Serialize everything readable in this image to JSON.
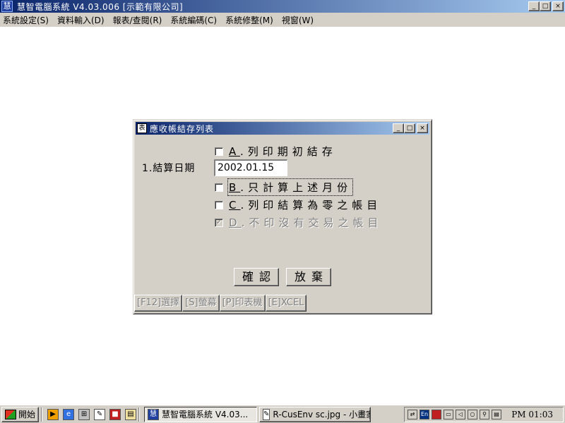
{
  "main_window": {
    "title": "慧智電腦系統 V4.03.006 [示範有限公司]",
    "app_icon": "慧",
    "caption_buttons": [
      "_",
      "□",
      "×"
    ]
  },
  "menubar": [
    "系統設定(S)",
    "資料輸入(D)",
    "報表/查閱(R)",
    "系統編碼(C)",
    "系統修整(M)",
    "視窗(W)"
  ],
  "dialog": {
    "title": "應收帳結存列表",
    "icon": "表",
    "caption_buttons": [
      "_",
      "□",
      "×"
    ],
    "date_label": "1.結算日期",
    "date_value": "2002.01.15",
    "options": [
      {
        "key": "A",
        "text": ".列印期初結存",
        "checked": false,
        "enabled": true
      },
      {
        "key": "B",
        "text": ".只計算上述月份",
        "checked": false,
        "enabled": true,
        "focused": true
      },
      {
        "key": "C",
        "text": ".列印結算為零之帳目",
        "checked": false,
        "enabled": true
      },
      {
        "key": "D",
        "text": ".不印沒有交易之帳目",
        "checked": true,
        "enabled": false
      }
    ],
    "confirm_label": "確認",
    "cancel_label": "放棄",
    "function_keys": [
      "[F12]選擇",
      "[S]螢幕",
      "[P]印表機",
      "[E]XCEL"
    ]
  },
  "taskbar": {
    "start_label": "開始",
    "quick_launch": [
      "media-icon",
      "ie-icon",
      "explorer-icon",
      "notepad-icon",
      "app-icon",
      "folder-icon"
    ],
    "tasks": [
      {
        "label": "慧智電腦系統 V4.03...",
        "active": true
      },
      {
        "label": "R-CusEnv sc.jpg - 小畫家",
        "active": false
      }
    ],
    "tray_icons": [
      "network-icon",
      "En",
      "shield-icon",
      "monitor-icon",
      "volume-icon",
      "globe-icon",
      "search-icon",
      "printer-icon"
    ],
    "clock": "PM 01:03"
  }
}
